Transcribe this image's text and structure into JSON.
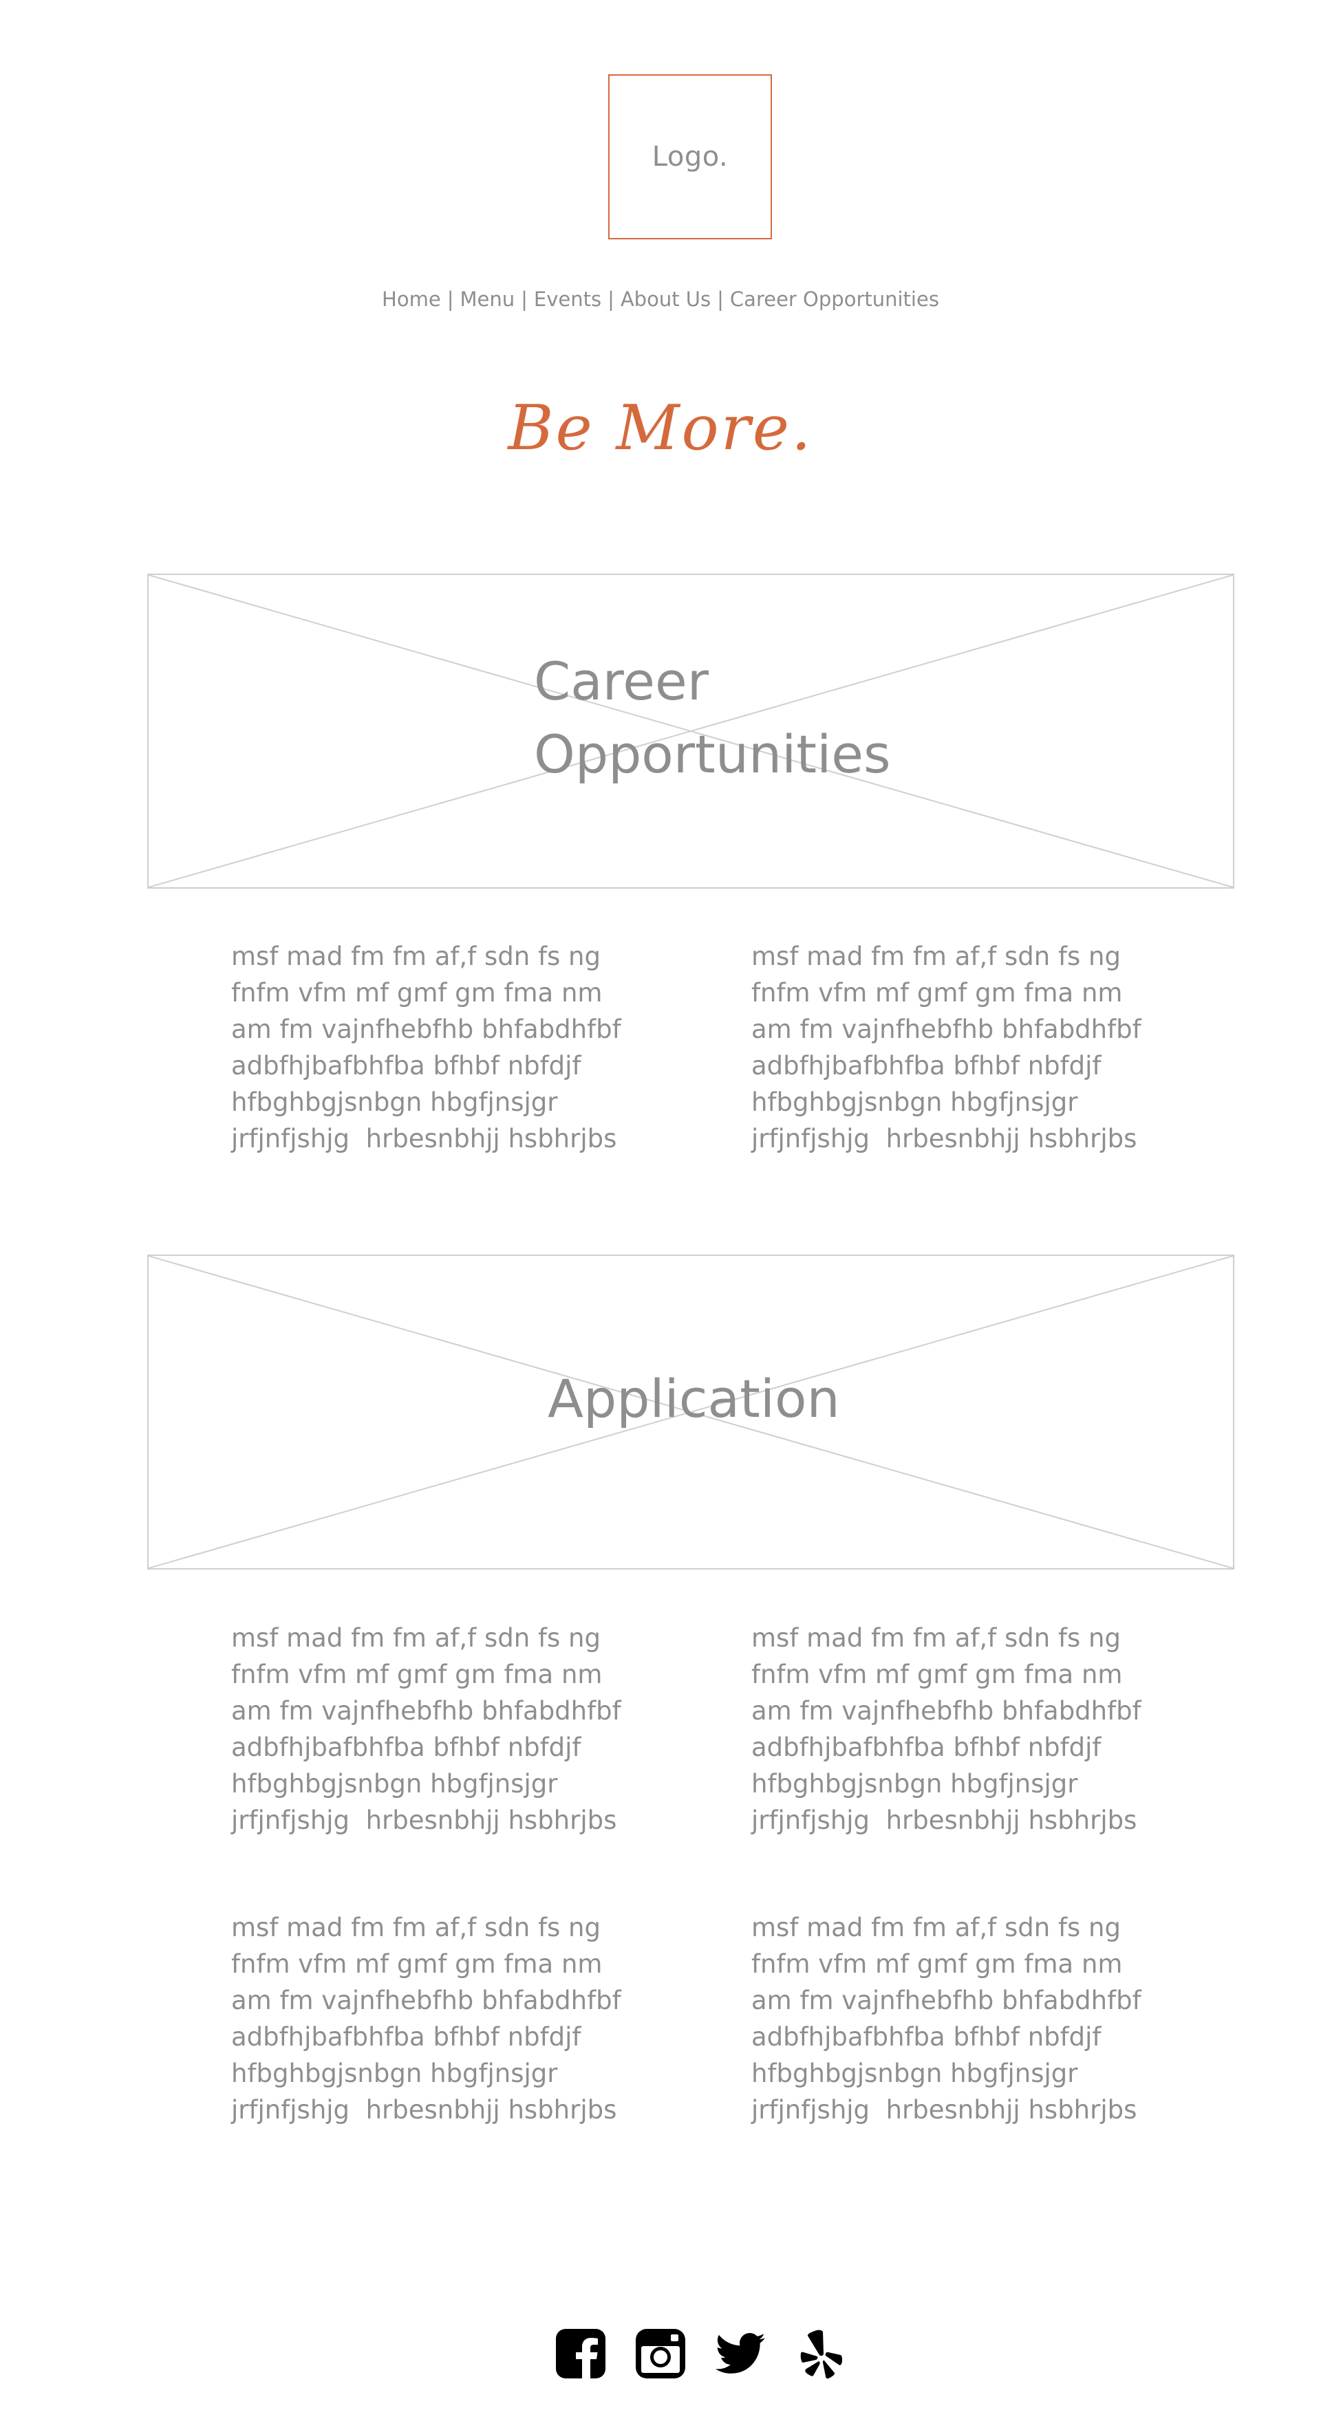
{
  "logo": {
    "text": "Logo."
  },
  "nav": {
    "items": [
      "Home",
      "Menu",
      "Events",
      "About Us",
      "Career Opportunities"
    ],
    "separator": "|"
  },
  "tagline": "Be More.",
  "banners": {
    "career": {
      "line1": "Career",
      "line2": "Opportunities"
    },
    "application": {
      "title": "Application"
    }
  },
  "sections": {
    "career_text": {
      "left": "msf mad fm fm af,f sdn fs ng\nfnfm vfm mf gmf gm fma nm\nam fm vajnfhebfhb bhfabdhfbf\nadbfhjbafbhfba bfhbf nbfdjf\nhfbghbgjsnbgn hbgfjnsjgr\njrfjnfjshjg  hrbesnbhjj hsbhrjbs",
      "right": "msf mad fm fm af,f sdn fs ng\nfnfm vfm mf gmf gm fma nm\nam fm vajnfhebfhb bhfabdhfbf\nadbfhjbafbhfba bfhbf nbfdjf\nhfbghbgjsnbgn hbgfjnsjgr\njrfjnfjshjg  hrbesnbhjj hsbhrjbs"
    },
    "application_text_1": {
      "left": "msf mad fm fm af,f sdn fs ng\nfnfm vfm mf gmf gm fma nm\nam fm vajnfhebfhb bhfabdhfbf\nadbfhjbafbhfba bfhbf nbfdjf\nhfbghbgjsnbgn hbgfjnsjgr\njrfjnfjshjg  hrbesnbhjj hsbhrjbs",
      "right": "msf mad fm fm af,f sdn fs ng\nfnfm vfm mf gmf gm fma nm\nam fm vajnfhebfhb bhfabdhfbf\nadbfhjbafbhfba bfhbf nbfdjf\nhfbghbgjsnbgn hbgfjnsjgr\njrfjnfjshjg  hrbesnbhjj hsbhrjbs"
    },
    "application_text_2": {
      "left": "msf mad fm fm af,f sdn fs ng\nfnfm vfm mf gmf gm fma nm\nam fm vajnfhebfhb bhfabdhfbf\nadbfhjbafbhfba bfhbf nbfdjf\nhfbghbgjsnbgn hbgfjnsjgr\njrfjnfjshjg  hrbesnbhjj hsbhrjbs",
      "right": "msf mad fm fm af,f sdn fs ng\nfnfm vfm mf gmf gm fma nm\nam fm vajnfhebfhb bhfabdhfbf\nadbfhjbafbhfba bfhbf nbfdjf\nhfbghbgjsnbgn hbgfjnsjgr\njrfjnfjshjg  hrbesnbhjj hsbhrjbs"
    }
  },
  "social": {
    "icons": [
      "facebook-icon",
      "instagram-icon",
      "twitter-icon",
      "yelp-icon"
    ]
  },
  "colors": {
    "accent": "#d46a3c",
    "text": "#8e8e8e",
    "placeholder_border": "#cfcfcf",
    "social": "#000000"
  }
}
